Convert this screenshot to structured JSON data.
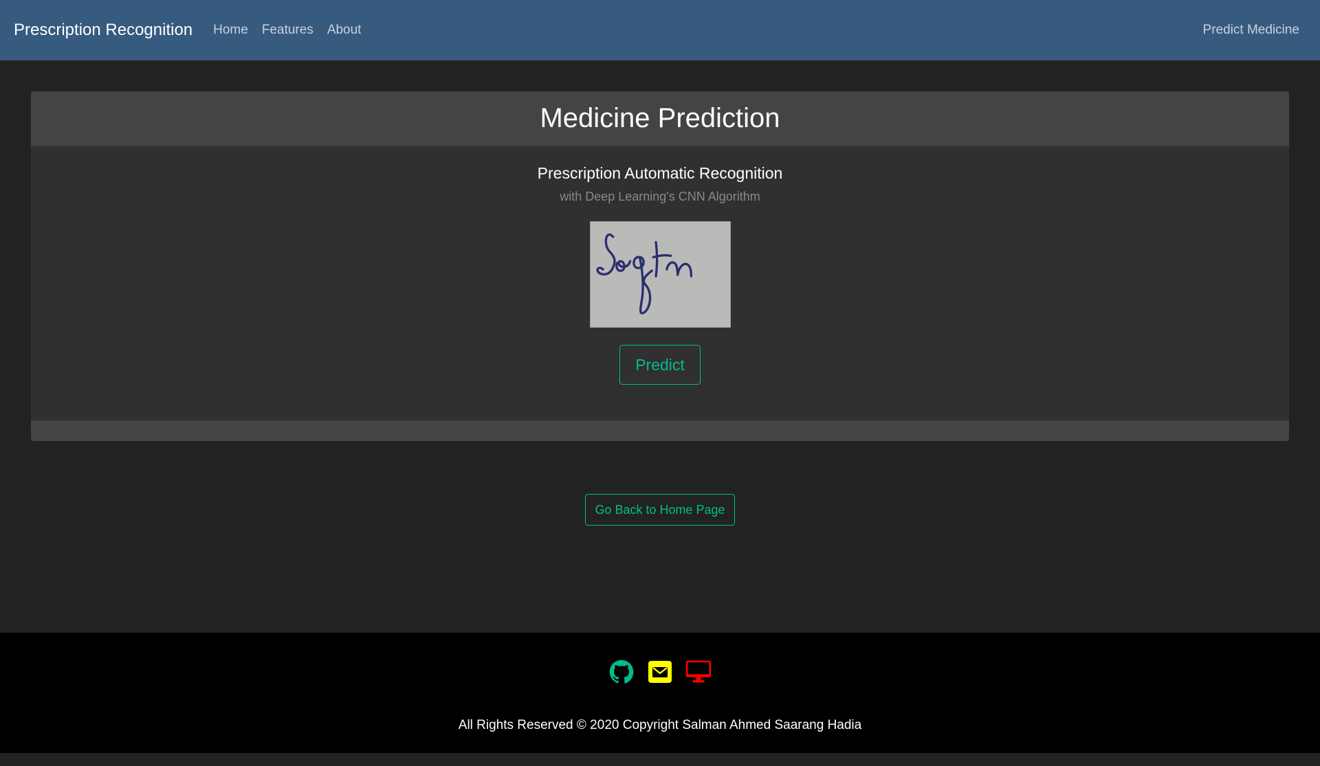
{
  "navbar": {
    "brand": "Prescription Recognition",
    "links": [
      "Home",
      "Features",
      "About"
    ],
    "right_link": "Predict Medicine",
    "bg_color": "#375a7f"
  },
  "card": {
    "title": "Medicine Prediction",
    "subtitle": "Prescription Automatic Recognition",
    "muted_text": "with Deep Learning's CNN Algorithm",
    "image_alt": "Handwritten prescription sample",
    "predict_label": "Predict"
  },
  "back_button": {
    "label": "Go Back to Home Page"
  },
  "footer": {
    "icons": [
      "github-icon",
      "mail-icon",
      "desktop-icon"
    ],
    "icon_colors": [
      "#00bc8c",
      "#ffff00",
      "#ff0000"
    ],
    "copyright": "All Rights Reserved © 2020 Copyright Salman Ahmed Saarang Hadia"
  },
  "colors": {
    "accent": "#00bc8c",
    "page_bg": "#222222",
    "card_bg": "#303030",
    "card_header_bg": "#444444"
  }
}
